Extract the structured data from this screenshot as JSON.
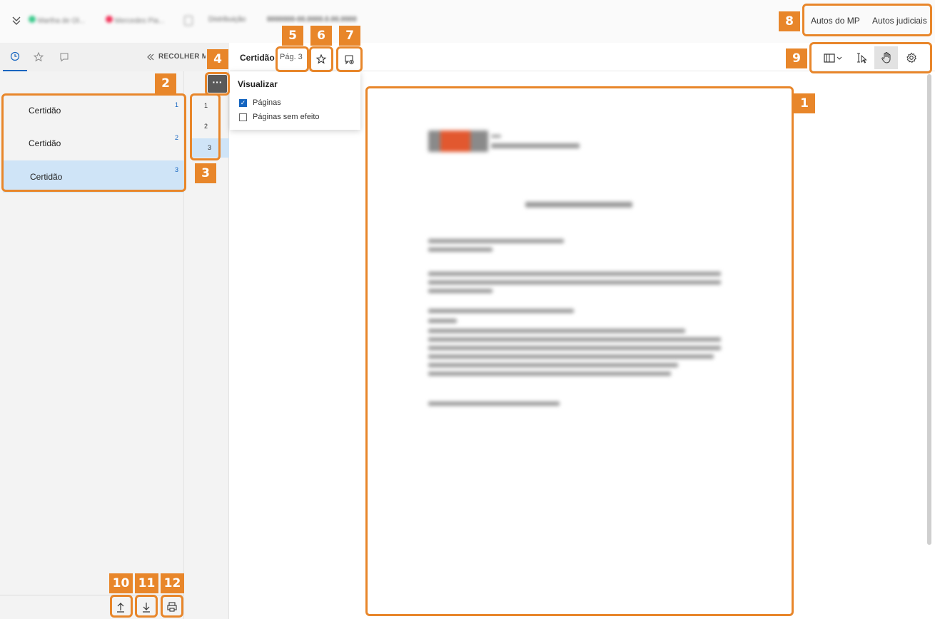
{
  "topbar": {
    "chevron_icon": "double-chevron-down-icon",
    "pill1": "Martha de Ol...",
    "pill2": "Mercedes Pia...",
    "doc_label": "Distribuição",
    "doc_number": "0000000-00.0000.0.00.0000",
    "tabs": [
      "Autos do MP",
      "Autos judiciais"
    ]
  },
  "sidebar": {
    "tab_icons": [
      "clock-icon",
      "star-icon",
      "comment-icon"
    ],
    "collapse_label": "RECOLHER M",
    "documents": [
      {
        "label": "Certidão",
        "num": "1"
      },
      {
        "label": "Certidão",
        "num": "2"
      },
      {
        "label": "Certidão",
        "num": "3"
      }
    ],
    "pages": [
      "1",
      "2",
      "3"
    ],
    "bottom_icons": [
      "upload-icon",
      "download-icon",
      "print-icon"
    ]
  },
  "toolbar": {
    "doc_title": "Certidão",
    "page_label": "Pág. 3",
    "more_icon": "ellipsis-icon"
  },
  "dropdown": {
    "title": "Visualizar",
    "options": [
      {
        "label": "Páginas",
        "checked": true
      },
      {
        "label": "Páginas sem efeito",
        "checked": false
      }
    ]
  },
  "viewer_tools": [
    "book-icon",
    "text-select-icon",
    "hand-icon",
    "gear-icon"
  ],
  "callouts": [
    "1",
    "2",
    "3",
    "4",
    "5",
    "6",
    "7",
    "8",
    "9",
    "10",
    "11",
    "12"
  ],
  "colors": {
    "accent": "#e8862a",
    "selection": "#cfe4f7",
    "link": "#1565c0"
  }
}
